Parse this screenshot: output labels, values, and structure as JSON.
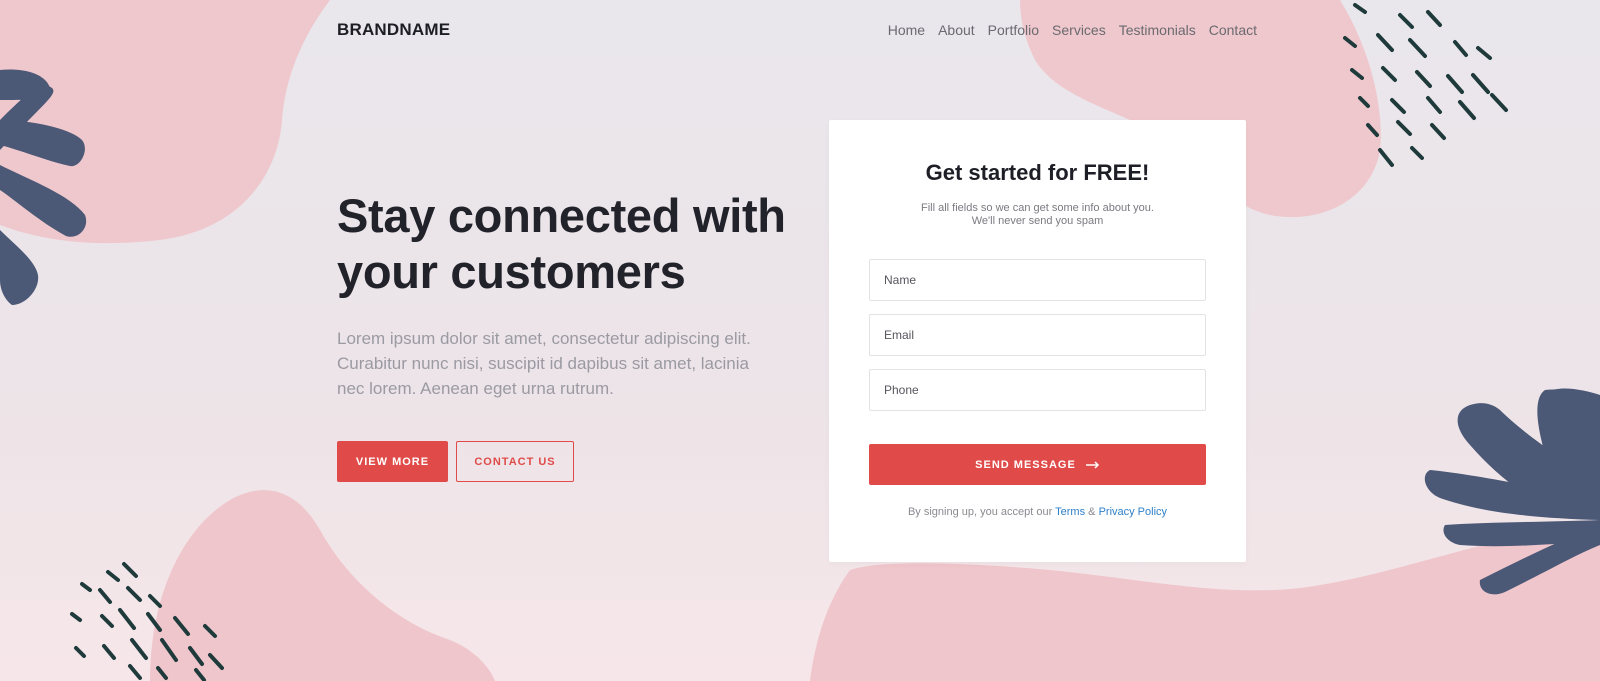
{
  "nav": {
    "brand": "BRANDNAME",
    "links": [
      "Home",
      "About",
      "Portfolio",
      "Services",
      "Testimonials",
      "Contact"
    ]
  },
  "hero": {
    "title_line1": "Stay connected with",
    "title_line2": "your customers",
    "description": "Lorem ipsum dolor sit amet, consectetur adipiscing elit. Curabitur nunc nisi, suscipit id dapibus sit amet, lacinia nec lorem. Aenean eget urna rutrum.",
    "primary_button": "VIEW MORE",
    "secondary_button": "CONTACT US"
  },
  "form": {
    "title": "Get started for FREE!",
    "subtitle_line1": "Fill all fields so we can get some info about you.",
    "subtitle_line2": "We'll never send you spam",
    "name_placeholder": "Name",
    "email_placeholder": "Email",
    "phone_placeholder": "Phone",
    "submit_label": "SEND MESSAGE",
    "submit_icon": "arrow-right-icon",
    "terms_prefix": "By signing up, you accept our",
    "terms_link": "Terms",
    "terms_and": "&",
    "privacy_link": "Privacy Policy"
  },
  "colors": {
    "accent": "#e04b49",
    "blob": "#efc6cb",
    "leaf": "#4b5876",
    "dash": "#1f3a3b",
    "link": "#2f80c9"
  }
}
